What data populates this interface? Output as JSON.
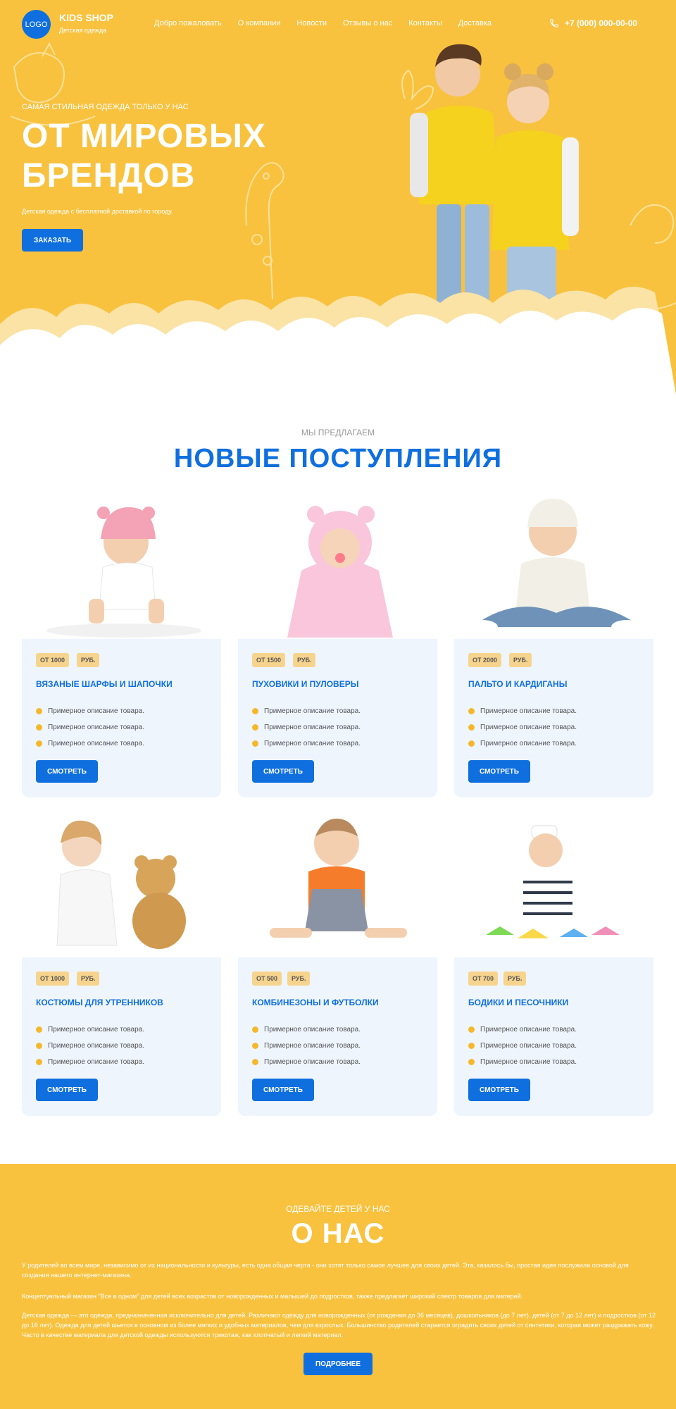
{
  "header": {
    "logo_text": "LOGO",
    "brand_name": "KIDS SHOP",
    "brand_subtitle": "Детская одежда",
    "menu": [
      {
        "label": "Добро пожаловать"
      },
      {
        "label": "О компании"
      },
      {
        "label": "Новости"
      },
      {
        "label": "Отзывы о нас"
      },
      {
        "label": "Контакты"
      },
      {
        "label": "Доставка"
      }
    ],
    "phone": "+7 (000) 000-00-00",
    "phone_icon": "phone-icon"
  },
  "hero": {
    "kicker": "САМАЯ СТИЛЬНАЯ ОДЕЖДА ТОЛЬКО У НАС",
    "title_line1": "ОТ МИРОВЫХ",
    "title_line2": "БРЕНДОВ",
    "subtitle": "Детская одежда с бесплатной доставкой по городу.",
    "button_label": "ЗАКАЗАТЬ"
  },
  "offers": {
    "kicker": "МЫ ПРЕДЛАГАЕМ",
    "title": "НОВЫЕ ПОСТУПЛЕНИЯ",
    "cards": [
      {
        "price": "ОТ 1000",
        "currency": "РУБ.",
        "title": "ВЯЗАНЫЕ ШАРФЫ И ШАПОЧКИ",
        "features": [
          "Примерное описание товара.",
          "Примерное описание товара.",
          "Примерное описание товара."
        ],
        "button": "СМОТРЕТЬ"
      },
      {
        "price": "ОТ 1500",
        "currency": "РУБ.",
        "title": "ПУХОВИКИ И ПУЛОВЕРЫ",
        "features": [
          "Примерное описание товара.",
          "Примерное описание товара.",
          "Примерное описание товара."
        ],
        "button": "СМОТРЕТЬ"
      },
      {
        "price": "ОТ 2000",
        "currency": "РУБ.",
        "title": "ПАЛЬТО И КАРДИГАНЫ",
        "features": [
          "Примерное описание товара.",
          "Примерное описание товара.",
          "Примерное описание товара."
        ],
        "button": "СМОТРЕТЬ"
      },
      {
        "price": "ОТ 1000",
        "currency": "РУБ.",
        "title": "КОСТЮМЫ ДЛЯ УТРЕННИКОВ",
        "features": [
          "Примерное описание товара.",
          "Примерное описание товара.",
          "Примерное описание товара."
        ],
        "button": "СМОТРЕТЬ"
      },
      {
        "price": "ОТ 500",
        "currency": "РУБ.",
        "title": "КОМБИНЕЗОНЫ И ФУТБОЛКИ",
        "features": [
          "Примерное описание товара.",
          "Примерное описание товара.",
          "Примерное описание товара."
        ],
        "button": "СМОТРЕТЬ"
      },
      {
        "price": "ОТ 700",
        "currency": "РУБ.",
        "title": "БОДИКИ И ПЕСОЧНИКИ",
        "features": [
          "Примерное описание товара.",
          "Примерное описание товара.",
          "Примерное описание товара."
        ],
        "button": "СМОТРЕТЬ"
      }
    ]
  },
  "about": {
    "kicker": "ОДЕВАЙТЕ ДЕТЕЙ У НАС",
    "title": "О НАС",
    "paragraphs": [
      "У родителей во всем мире, независимо от их национальности и культуры, есть одна общая черта - они хотят только самое лучшее для своих детей. Эта, казалось бы, простая идея послужила основой для создания нашего интернет-магазина.",
      "Концептуальный магазин \"Все в одном\" для детей всех возрастов от новорожденных и малышей до подростков, также предлагает широкий спектр товаров для матерей.",
      "Детская одежда — это одежда, предназначенная исключительно для детей. Различают одежду для новорожденных (от рождения до 36 месяцев), дошкольников (до 7 лет), детей (от 7 до 12 лет) и подростков (от 12 до 16 лет). Одежда для детей шьется в основном из более мягких и удобных материалов, чем для взрослых. Большинство родителей старается оградить своих детей от синтетики, которая может раздражать кожу. Часто в качестве материала для детской одежды используются трикотаж, как хлопчатый и легкий материал."
    ],
    "button_label": "ПОДРОБНЕЕ"
  },
  "colors": {
    "accent_yellow": "#f8c23f",
    "primary_blue": "#0f6fde",
    "card_bg": "#eef5fd",
    "badge_bg": "#f7d48d"
  }
}
